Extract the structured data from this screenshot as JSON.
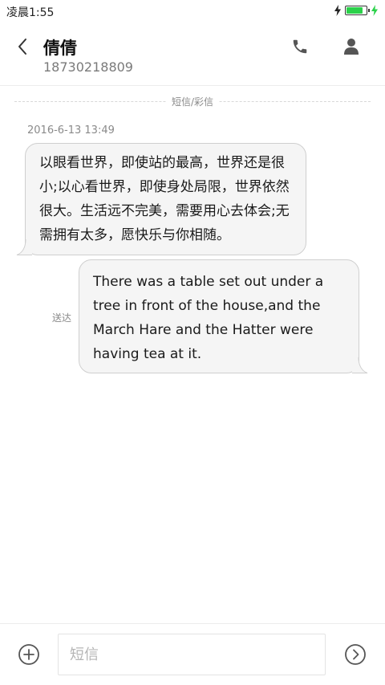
{
  "status_bar": {
    "time": "凌晨1:55",
    "battery_level": 0.85,
    "battery_color": "#2bd14a"
  },
  "header": {
    "contact_name": "倩倩",
    "contact_number": "18730218809",
    "back_icon": "chevron-left-icon",
    "call_icon": "phone-icon",
    "contact_icon": "person-icon"
  },
  "conversation": {
    "divider_label": "短信/彩信",
    "timestamp": "2016-6-13 13:49",
    "messages": [
      {
        "direction": "incoming",
        "text": "以眼看世界，即使站的最高，世界还是很小;以心看世界，即使身处局限，世界依然很大。生活远不完美，需要用心去体会;无需拥有太多，愿快乐与你相随。"
      },
      {
        "direction": "outgoing",
        "status": "送达",
        "text": "There was a table set out under a tree in front of the house,and the March Hare and the Hatter were having tea at it."
      }
    ]
  },
  "composer": {
    "placeholder": "短信",
    "value": "",
    "add_icon": "plus-circle-icon",
    "send_icon": "send-arrow-icon"
  }
}
